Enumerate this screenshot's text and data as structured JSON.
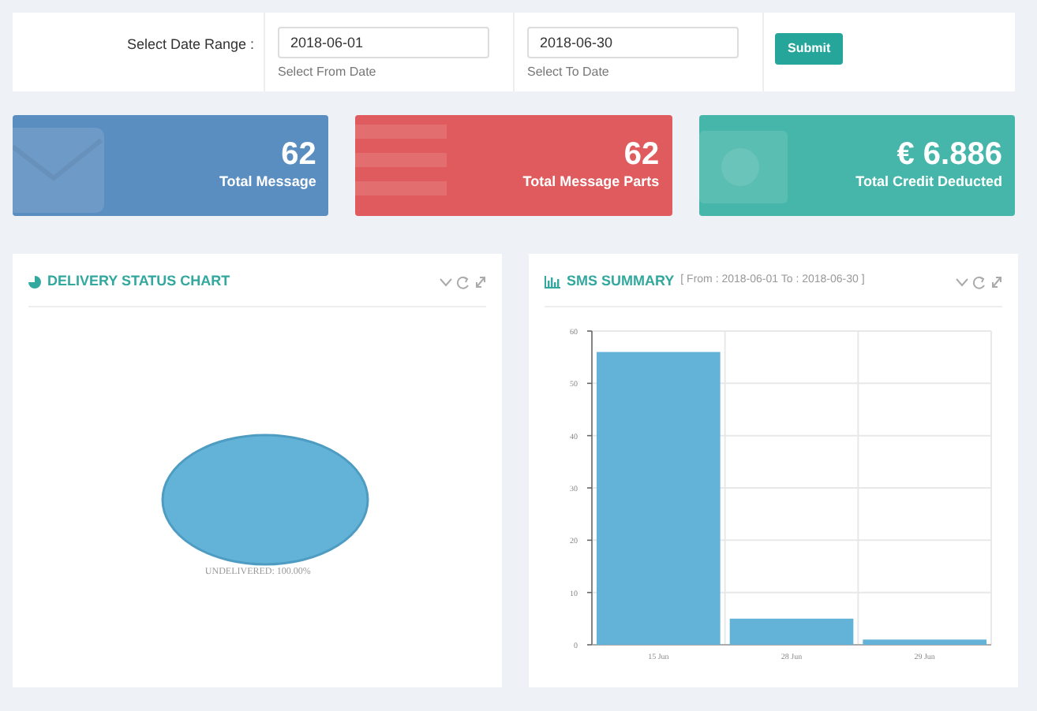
{
  "filter": {
    "label": "Select Date Range :",
    "from": {
      "value": "2018-06-01",
      "hint": "Select From Date"
    },
    "to": {
      "value": "2018-06-30",
      "hint": "Select To Date"
    },
    "submit": "Submit"
  },
  "stats": [
    {
      "kind": "envelope",
      "value": "62",
      "label": "Total Message",
      "color": "#5a8dc0"
    },
    {
      "kind": "list",
      "value": "62",
      "label": "Total Message Parts",
      "color": "#e05b5d"
    },
    {
      "kind": "money",
      "value": "€ 6.886",
      "label": "Total Credit Deducted",
      "color": "#45b6a9"
    }
  ],
  "delivery_panel": {
    "title": "DELIVERY STATUS CHART",
    "chart_data": {
      "type": "pie",
      "values": [
        100
      ],
      "value_labels": [
        "UNDELIVERED: 100.00%"
      ]
    }
  },
  "sms_panel": {
    "title": "SMS SUMMARY",
    "subtitle": "[ From : 2018-06-01 To : 2018-06-30 ]",
    "chart_data": {
      "type": "bar",
      "categories": [
        "15 Jun",
        "28 Jun",
        "29 Jun"
      ],
      "series": [
        {
          "color": "#63b3d9",
          "values": [
            56,
            5,
            1
          ]
        }
      ],
      "grid": true,
      "ylim": [
        0,
        60
      ],
      "yticks": [
        0,
        10,
        20,
        30,
        40,
        50,
        60
      ]
    }
  }
}
